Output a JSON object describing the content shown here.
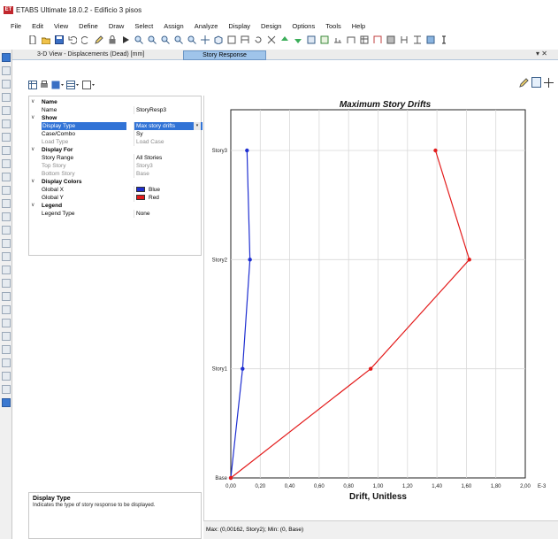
{
  "window": {
    "title": "ETABS Ultimate 18.0.2 - Edificio 3 pisos",
    "logo_text": "ET"
  },
  "menu": [
    "File",
    "Edit",
    "View",
    "Define",
    "Draw",
    "Select",
    "Assign",
    "Analyze",
    "Display",
    "Design",
    "Options",
    "Tools",
    "Help"
  ],
  "tabs": {
    "tab1": "3-D View  - Displacements (Dead)  [mm]",
    "tab2": "Story Response",
    "close": "▾ ✕"
  },
  "properties": {
    "name_section": "Name",
    "name_label": "Name",
    "name_value": "StoryResp3",
    "show_section": "Show",
    "display_type_label": "Display Type",
    "display_type_value": "Max story drifts",
    "case_label": "Case/Combo",
    "case_value": "Sy",
    "load_type_label": "Load Type",
    "load_type_value": "Load Case",
    "display_for_section": "Display For",
    "story_range_label": "Story Range",
    "story_range_value": "All Stories",
    "top_story_label": "Top Story",
    "top_story_value": "Story3",
    "bottom_story_label": "Bottom Story",
    "bottom_story_value": "Base",
    "colors_section": "Display Colors",
    "global_x_label": "Global X",
    "global_x_value": "Blue",
    "global_y_label": "Global Y",
    "global_y_value": "Red",
    "legend_section": "Legend",
    "legend_type_label": "Legend Type",
    "legend_type_value": "None"
  },
  "help": {
    "title": "Display Type",
    "text": "Indicates the type of story response to be displayed."
  },
  "status": {
    "text": "Max: (0,00162, Story2);  Min: (0, Base)"
  },
  "colors": {
    "series_x": "#1f2fd1",
    "series_y": "#e31b1b",
    "selection": "#3173d6"
  },
  "chart_data": {
    "type": "line",
    "title": "Maximum Story Drifts",
    "xlabel": "Drift, Unitless",
    "x_unit_label": "E-3",
    "xlim": [
      0,
      2.0
    ],
    "x_ticks": [
      0,
      0.2,
      0.4,
      0.6,
      0.8,
      1.0,
      1.2,
      1.4,
      1.6,
      1.8,
      2.0
    ],
    "x_tick_labels": [
      "0,00",
      "0,20",
      "0,40",
      "0,60",
      "0,80",
      "1,00",
      "1,20",
      "1,40",
      "1,60",
      "1,80",
      "2,00"
    ],
    "stories": [
      "Base",
      "Story1",
      "Story2",
      "Story3"
    ],
    "grid": true,
    "series": [
      {
        "name": "Global X",
        "color": "#1f2fd1",
        "values": [
          0.0,
          0.08,
          0.13,
          0.11
        ]
      },
      {
        "name": "Global Y",
        "color": "#e31b1b",
        "values": [
          0.0,
          0.95,
          1.62,
          1.39
        ]
      }
    ]
  }
}
